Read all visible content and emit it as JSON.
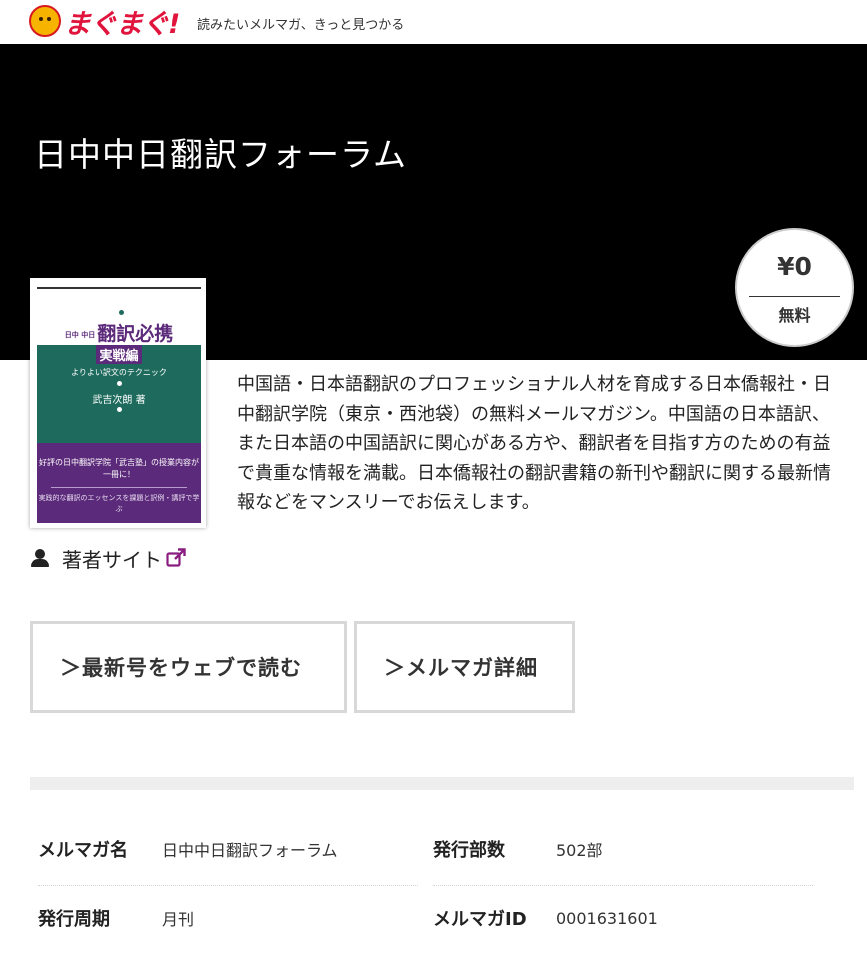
{
  "header": {
    "logo_text": "まぐまぐ!",
    "tagline": "読みたいメルマガ、きっと見つかる"
  },
  "magazine": {
    "title": "日中中日翻訳フォーラム",
    "description": "中国語・日本語翻訳のプロフェッショナル人材を育成する日本僑報社・日中翻訳学院（東京・西池袋）の無料メールマガジン。中国語の日本語訳、また日本語の中国語訳に関心がある方や、翻訳者を目指す方のための有益で貴重な情報を満載。日本僑報社の翻訳書籍の新刊や翻訳に関する最新情報などをマンスリーでお伝えします。",
    "author_site_label": "著者サイト"
  },
  "price": {
    "value": "¥0",
    "label": "無料"
  },
  "cover": {
    "title_small": "日中 中日",
    "title": "翻訳必携",
    "subtitle": "実戦編",
    "technique": "よりよい訳文のテクニック",
    "author": "武吉次朗 著",
    "blurb": "好評の日中翻訳学院「武吉塾」の授業内容が一冊に！",
    "blurb2": "実践的な翻訳のエッセンスを課題と訳例・講評で学ぶ",
    "colors": {
      "green": "#1e6b5e",
      "purple": "#5c2a7a"
    }
  },
  "buttons": {
    "latest": "＞最新号をウェブで読む",
    "detail": "＞メルマガ詳細"
  },
  "info": {
    "name_key": "メルマガ名",
    "name_val": "日中中日翻訳フォーラム",
    "count_key": "発行部数",
    "count_val": "502部",
    "freq_key": "発行周期",
    "freq_val": "月刊",
    "id_key": "メルマガID",
    "id_val": "0001631601"
  },
  "icons": {
    "author": "user-icon",
    "external": "external-link-icon"
  },
  "colors": {
    "brand": "#e0143c",
    "external_link": "#8a1d7f",
    "hero_background": "#000000"
  }
}
